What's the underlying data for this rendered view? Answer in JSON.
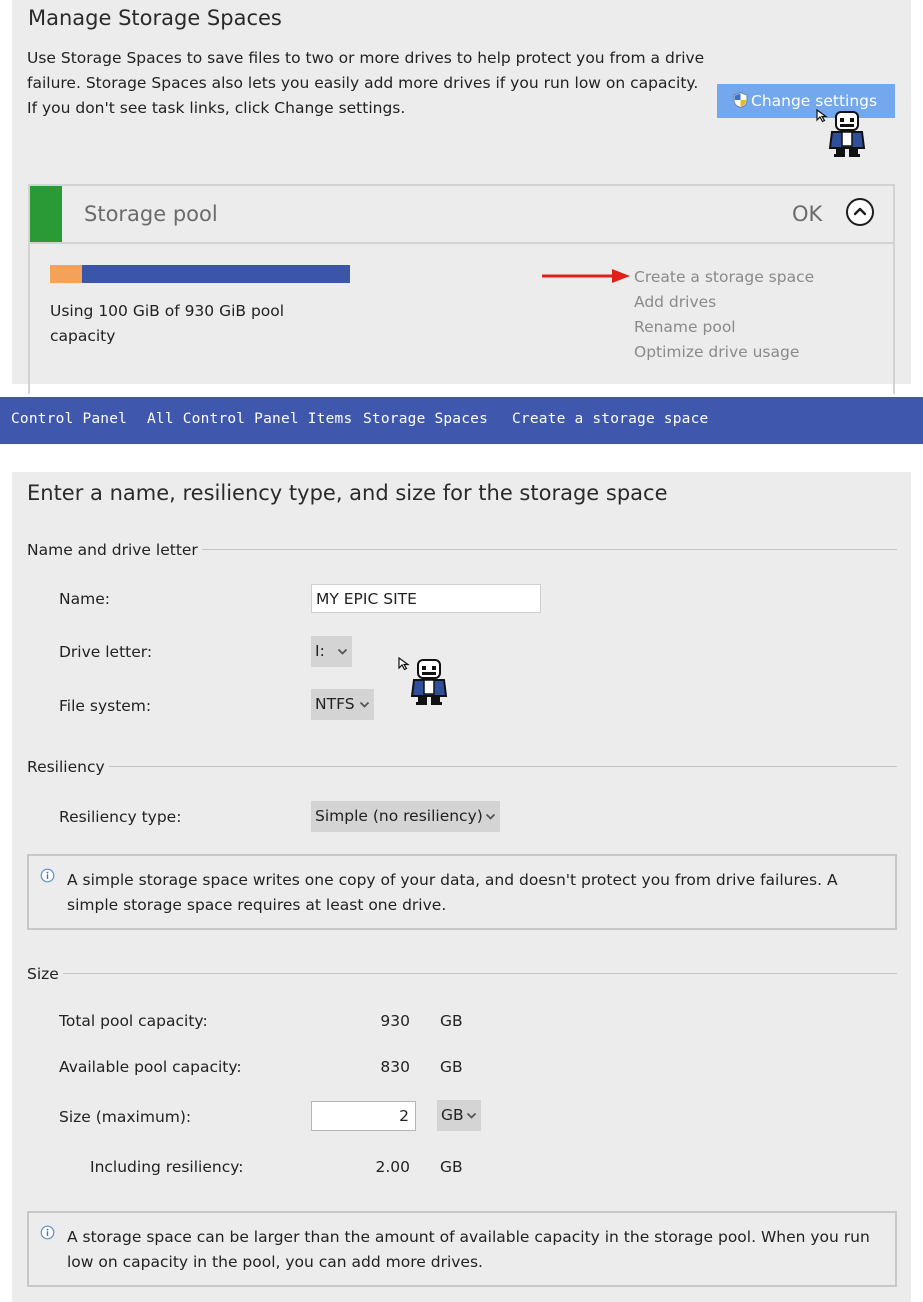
{
  "manage": {
    "title": "Manage Storage Spaces",
    "description": "Use Storage Spaces to save files to two or more drives to help protect you from a drive failure. Storage Spaces also lets you easily add more drives if you run low on capacity. If you don't see task links, click Change settings.",
    "change_settings_label": "Change settings"
  },
  "pool": {
    "title": "Storage pool",
    "status": "OK",
    "usage_text": "Using 100 GiB of 930 GiB pool capacity",
    "used_gib": 100,
    "total_gib": 930,
    "links": [
      "Create a storage space",
      "Add drives",
      "Rename pool",
      "Optimize drive usage"
    ]
  },
  "breadcrumb": [
    "Control Panel",
    "All Control Panel Items",
    "Storage Spaces",
    "Create a storage space"
  ],
  "form": {
    "title": "Enter a name, resiliency type, and size for the storage space",
    "name_section": {
      "label": "Name and drive letter",
      "name_label": "Name:",
      "name_value": "MY EPIC SITE",
      "drive_letter_label": "Drive letter:",
      "drive_letter_value": "I:",
      "file_system_label": "File system:",
      "file_system_value": "NTFS"
    },
    "resiliency_section": {
      "label": "Resiliency",
      "type_label": "Resiliency type:",
      "type_value": "Simple (no resiliency)",
      "info": "A simple storage space writes one copy of your data, and doesn't protect you from drive failures. A simple storage space requires at least one drive."
    },
    "size_section": {
      "label": "Size",
      "total_label": "Total pool capacity:",
      "total_value": "930",
      "total_unit": "GB",
      "available_label": "Available pool capacity:",
      "available_value": "830",
      "available_unit": "GB",
      "size_label": "Size (maximum):",
      "size_value": "2",
      "size_unit": "GB",
      "including_label": "Including resiliency:",
      "including_value": "2.00",
      "including_unit": "GB",
      "info": "A storage space can be larger than the amount of available capacity in the storage pool. When you run low on capacity in the pool, you can add more drives."
    }
  },
  "colors": {
    "accent_button": "#73a8ef",
    "breadcrumb_bar": "#3f57ad",
    "pool_green": "#2a9a34",
    "usage_used": "#f4a15a",
    "usage_bar": "#3b55a8",
    "arrow": "#e0201b"
  },
  "icons": [
    "shield-icon",
    "chevron-up-icon",
    "chevron-down-icon",
    "info-icon",
    "arrow-right-icon",
    "cursor-icon"
  ]
}
